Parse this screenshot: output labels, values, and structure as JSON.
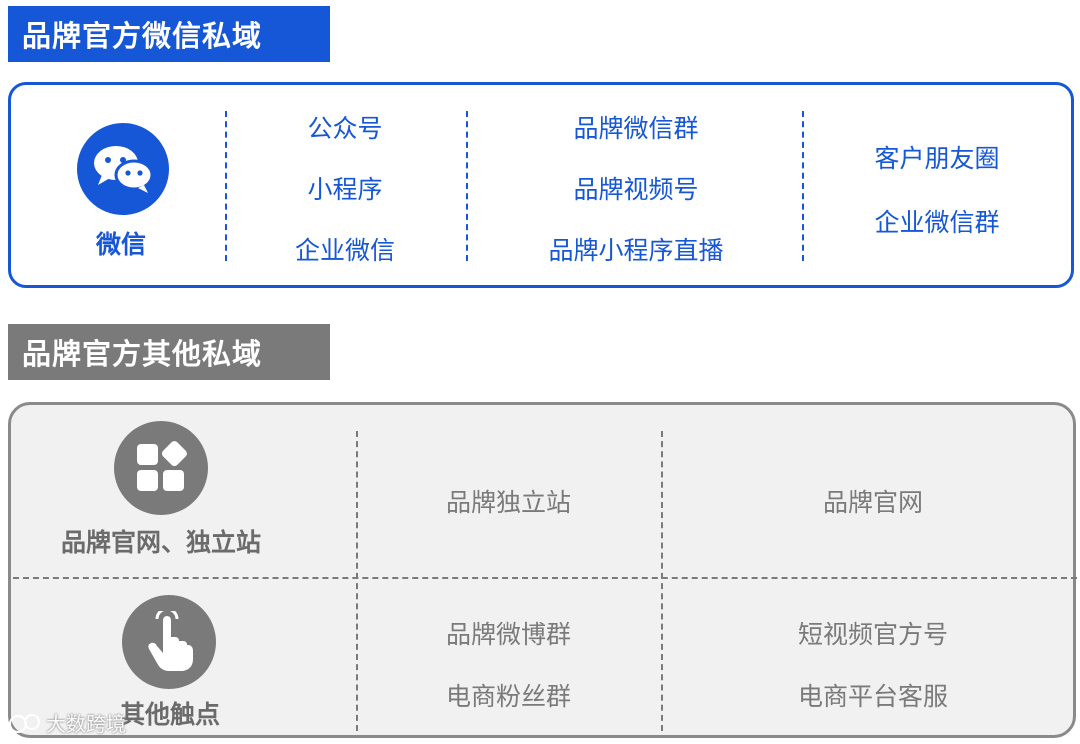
{
  "sections": {
    "wechat_title": "品牌官方微信私域",
    "other_title": "品牌官方其他私域"
  },
  "wechat": {
    "label": "微信",
    "col1": [
      "公众号",
      "小程序",
      "企业微信"
    ],
    "col2": [
      "品牌微信群",
      "品牌视频号",
      "品牌小程序直播"
    ],
    "col3": [
      "客户朋友圈",
      "企业微信群"
    ]
  },
  "other": {
    "row1": {
      "label": "品牌官网、独立站",
      "item1": "品牌独立站",
      "item2": "品牌官网"
    },
    "row2": {
      "label": "其他触点",
      "col1": [
        "品牌微博群",
        "电商粉丝群"
      ],
      "col2": [
        "短视频官方号",
        "电商平台客服"
      ]
    }
  },
  "watermark": "大数跨境",
  "colors": {
    "accent": "#1557d6",
    "gray": "#7a7a7a",
    "panel_bg": "#f1f1f1"
  },
  "icons": [
    "wechat-icon",
    "website-grid-icon",
    "touch-hand-icon"
  ]
}
